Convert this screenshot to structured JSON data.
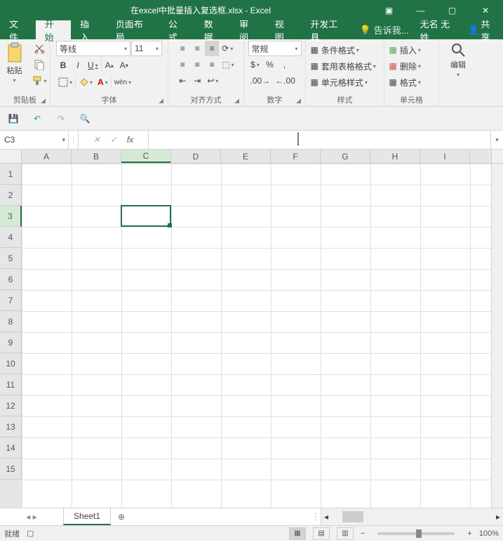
{
  "title": "在excel中批量插入复选框.xlsx - Excel",
  "win": {
    "min": "—",
    "max": "▢",
    "close": "✕",
    "restore": "▣"
  },
  "tabs": {
    "file": "文件",
    "home": "开始",
    "insert": "插入",
    "layout": "页面布局",
    "formulas": "公式",
    "data": "数据",
    "review": "审阅",
    "view": "视图",
    "dev": "开发工具",
    "tell": "告诉我...",
    "user": "无名 无姓",
    "share": "共享"
  },
  "ribbon": {
    "clipboard": {
      "paste": "粘贴",
      "label": "剪贴板"
    },
    "font": {
      "name": "等线",
      "size": "11",
      "label": "字体",
      "b": "B",
      "i": "I",
      "u": "U",
      "ruby": "wén"
    },
    "align": {
      "label": "对齐方式"
    },
    "number": {
      "general": "常规",
      "label": "数字",
      "percent": "%",
      "comma": ","
    },
    "styles": {
      "cond": "条件格式",
      "tbl": "套用表格格式",
      "cell": "单元格样式",
      "label": "样式"
    },
    "cells_g": {
      "ins": "插入",
      "del": "删除",
      "fmt": "格式",
      "label": "单元格"
    },
    "editing": {
      "label": "编辑"
    }
  },
  "qat": {
    "save": "💾",
    "undo": "↶",
    "redo": "↷",
    "preview": "🔍"
  },
  "formula": {
    "namebox": "C3",
    "cancel": "✕",
    "enter": "✓",
    "fx": "fx",
    "value": ""
  },
  "cols": [
    "A",
    "B",
    "C",
    "D",
    "E",
    "F",
    "G",
    "H",
    "I"
  ],
  "rows": [
    "1",
    "2",
    "3",
    "4",
    "5",
    "6",
    "7",
    "8",
    "9",
    "10",
    "11",
    "12",
    "13",
    "14",
    "15"
  ],
  "sel": {
    "col": "C",
    "row": "3"
  },
  "sheet_tab": "Sheet1",
  "add_sheet": "⊕",
  "status": {
    "ready": "就绪",
    "zoom": "100%",
    "minus": "−",
    "plus": "+"
  }
}
